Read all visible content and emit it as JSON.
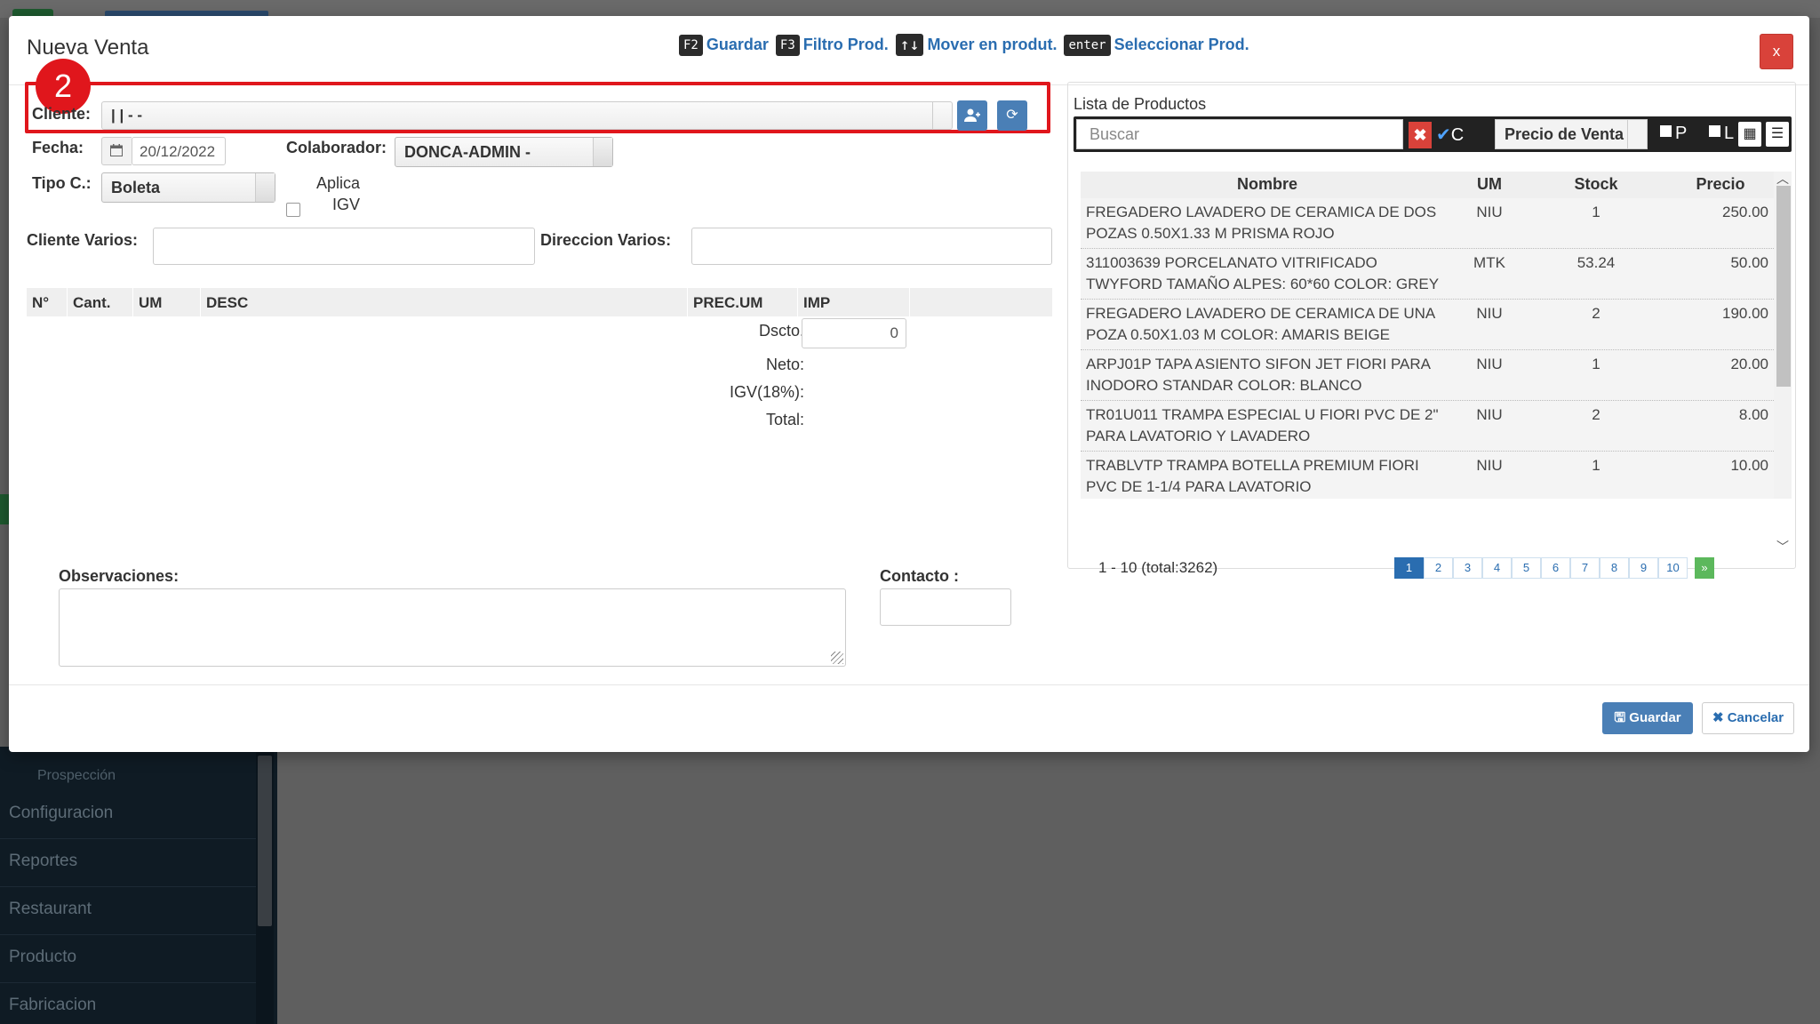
{
  "background": {
    "sidebar_sub_item": "Prospección",
    "sidebar_items": [
      "Configuracion",
      "Reportes",
      "Restaurant",
      "Producto",
      "Fabricacion"
    ]
  },
  "modal": {
    "title": "Nueva Venta",
    "close_label": "x",
    "shortcuts": [
      {
        "key": "F2",
        "label": "Guardar"
      },
      {
        "key": "F3",
        "label": "Filtro Prod."
      },
      {
        "key": "↑↓",
        "label": "Mover en produt."
      },
      {
        "key": "enter",
        "label": "Seleccionar Prod."
      }
    ],
    "step_badge": "2"
  },
  "form": {
    "cliente_label": "Cliente:",
    "cliente_value": "| | - -",
    "fecha_label": "Fecha:",
    "fecha_value": "20/12/2022",
    "colaborador_label": "Colaborador:",
    "colaborador_value": "DONCA-ADMIN -",
    "tipo_label": "Tipo C.:",
    "tipo_value": "Boleta",
    "aplica_igv_label_1": "Aplica",
    "aplica_igv_label_2": "IGV",
    "cliente_varios_label": "Cliente Varios:",
    "direccion_varios_label": "Direccion Varios:",
    "grid_columns": [
      "N°",
      "Cant.",
      "UM",
      "DESC",
      "PREC.UM",
      "IMP"
    ],
    "dscto_label": "Dscto.",
    "dscto_value": "0",
    "neto_label": "Neto:",
    "igv_label": "IGV(18%):",
    "total_label": "Total:",
    "observaciones_label": "Observaciones:",
    "contacto_label": "Contacto :"
  },
  "products": {
    "title": "Lista de Productos",
    "search_placeholder": "Buscar",
    "clear_label": "✖",
    "check_c_label": "C",
    "price_select": "Precio de Venta",
    "check_p_label": "P",
    "check_l_label": "L",
    "columns": {
      "name": "Nombre",
      "um": "UM",
      "stock": "Stock",
      "price": "Precio"
    },
    "rows": [
      {
        "name": "FREGADERO LAVADERO DE CERAMICA DE DOS POZAS 0.50X1.33 M PRISMA ROJO",
        "um": "NIU",
        "stock": "1",
        "price": "250.00"
      },
      {
        "name": "311003639 PORCELANATO VITRIFICADO TWYFORD TAMAÑO ALPES: 60*60 COLOR: GREY",
        "um": "MTK",
        "stock": "53.24",
        "price": "50.00"
      },
      {
        "name": "FREGADERO LAVADERO DE CERAMICA DE UNA POZA 0.50X1.03 M COLOR: AMARIS BEIGE",
        "um": "NIU",
        "stock": "2",
        "price": "190.00"
      },
      {
        "name": "ARPJ01P TAPA ASIENTO SIFON JET FIORI PARA INODORO STANDAR COLOR: BLANCO",
        "um": "NIU",
        "stock": "1",
        "price": "20.00"
      },
      {
        "name": "TR01U011 TRAMPA ESPECIAL U FIORI PVC DE 2\" PARA LAVATORIO Y LAVADERO",
        "um": "NIU",
        "stock": "2",
        "price": "8.00"
      },
      {
        "name": "TRABLVTP TRAMPA BOTELLA PREMIUM FIORI PVC DE 1-1/4 PARA LAVATORIO",
        "um": "NIU",
        "stock": "1",
        "price": "10.00"
      }
    ],
    "paging_text": "1 - 10 (total:3262)",
    "pages": [
      "1",
      "2",
      "3",
      "4",
      "5",
      "6",
      "7",
      "8",
      "9",
      "10"
    ],
    "next_label": "»"
  },
  "footer": {
    "save_label": "Guardar",
    "cancel_label": "Cancelar"
  }
}
